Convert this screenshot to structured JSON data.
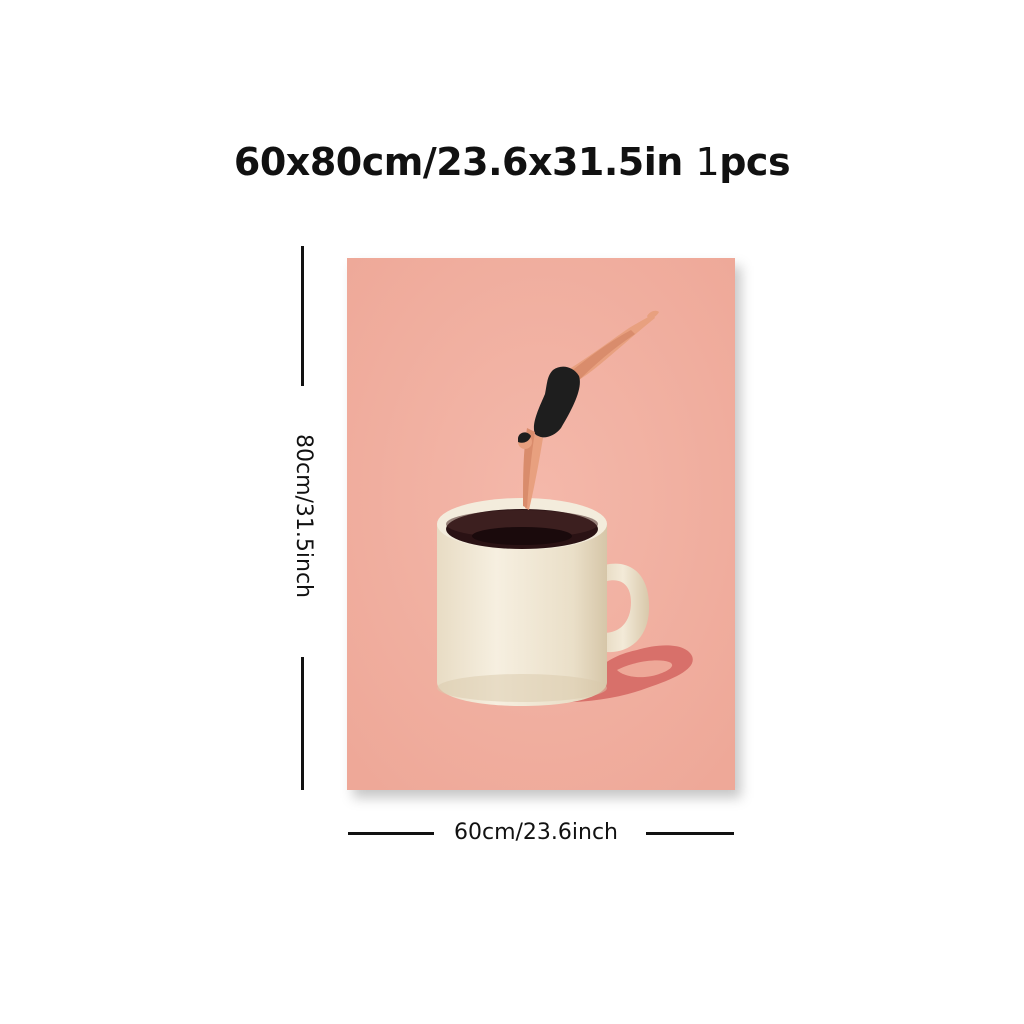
{
  "title": {
    "size_text": "60x80cm/23.6x31.5in",
    "quantity_number": "1",
    "quantity_unit": "pcs"
  },
  "dimensions": {
    "width_label": "60cm/23.6inch",
    "height_label": "80cm/31.5inch"
  },
  "artwork": {
    "subject": "diver-jumping-into-coffee-mug",
    "colors": {
      "background": "#f0ada0",
      "mug": "#efe6d3",
      "coffee": "#2a1214",
      "shadow": "#d9756a",
      "skin": "#e8a07f",
      "swimsuit": "#1e1e1e"
    }
  }
}
